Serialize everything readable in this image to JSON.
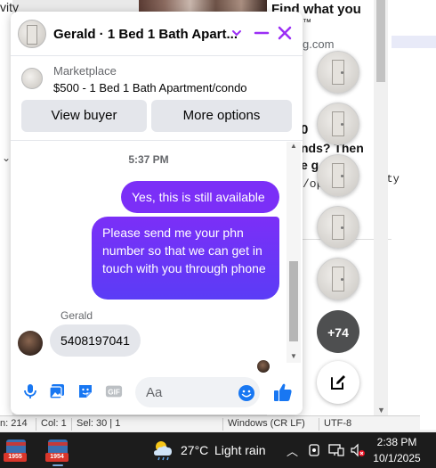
{
  "background": {
    "left_text": "vity",
    "heading": "Find what you",
    "tm": "™",
    "domain": "g.com",
    "number": "0",
    "text1": "nds? Then",
    "text2": "e g",
    "url": "/op",
    "mono": "erty"
  },
  "statusbar": {
    "line": "n: 214",
    "col": "Col: 1",
    "sel": "Sel: 30 | 1",
    "eol": "Windows (CR LF)",
    "encoding": "UTF-8"
  },
  "chat": {
    "header": {
      "title": "Gerald · 1 Bed 1 Bath Apart..."
    },
    "marketplace": {
      "label": "Marketplace",
      "listing": "$500 - 1 Bed 1 Bath Apartment/condo",
      "view_buyer": "View buyer",
      "more_options": "More options"
    },
    "timestamp": "5:37 PM",
    "messages_out": [
      "Yes, this is still available",
      "Please send me your phn number so that we can get in touch with you through phone"
    ],
    "sender_name": "Gerald",
    "message_in": "5408197041",
    "composer": {
      "placeholder": "Aa"
    },
    "accent_color": "#7b2ff7"
  },
  "chat_heads": {
    "more_count": "+74"
  },
  "taskbar": {
    "app1_tag": "1955",
    "app2_tag": "1954",
    "temperature": "27°C",
    "condition": "Light rain",
    "time": "2:38 PM",
    "date": "10/1/2025"
  }
}
